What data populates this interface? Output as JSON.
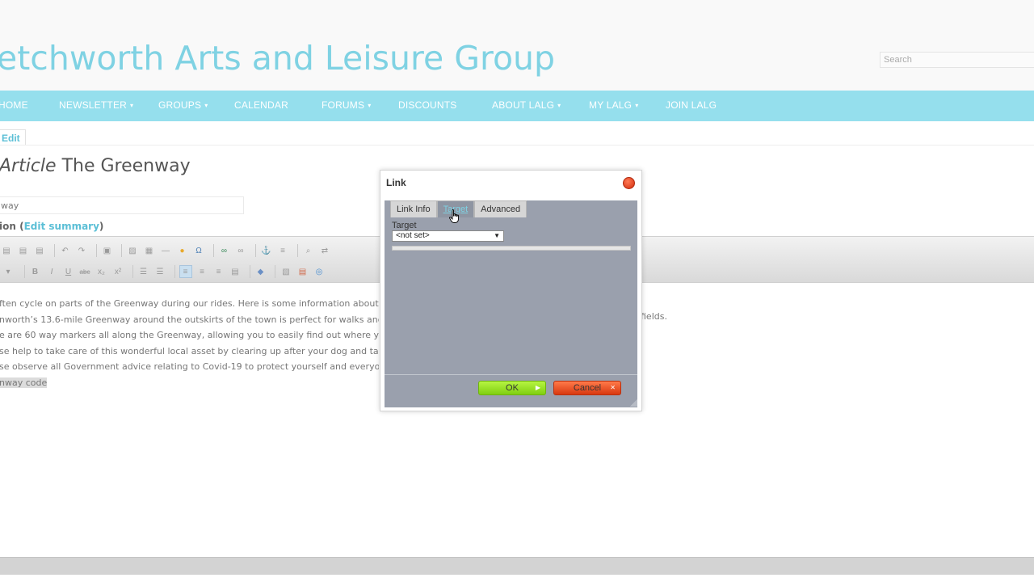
{
  "site": {
    "title": "etchworth Arts and Leisure Group",
    "search_placeholder": "Search"
  },
  "nav": {
    "items": [
      {
        "label": "HOME",
        "has_caret": false
      },
      {
        "label": "NEWSLETTER",
        "has_caret": true
      },
      {
        "label": "GROUPS",
        "has_caret": true
      },
      {
        "label": "CALENDAR",
        "has_caret": false
      },
      {
        "label": "FORUMS",
        "has_caret": true
      },
      {
        "label": "DISCOUNTS",
        "has_caret": false
      },
      {
        "label": "ABOUT LALG",
        "has_caret": true
      },
      {
        "label": "MY LALG",
        "has_caret": true
      },
      {
        "label": "JOIN LALG",
        "has_caret": false
      }
    ],
    "caret": "▾"
  },
  "page": {
    "edit_tab": "Edit",
    "title_italic": "Article",
    "title_rest": " The Greenway",
    "title_field_value": "way",
    "revision_prefix": "ion (",
    "revision_link": "Edit summary",
    "revision_suffix": ")"
  },
  "editor": {
    "lines": [
      "ften cycle on parts of the Greenway during our rides. Here is some information about",
      "nworth’s 13.6-mile Greenway around the outskirts of the town is perfect for walks and",
      "e are 60 way markers all along the Greenway, allowing you to easily find out where y",
      "se help to take care of this wonderful local asset by clearing up after  your dog and ta",
      "se observe all Government advice relating to Covid-19 to protect yourself and everyon"
    ],
    "highlighted_line": "nway code",
    "extra_text": "fields."
  },
  "dialog": {
    "title": "Link",
    "tabs": [
      {
        "label": "Link Info",
        "active": false
      },
      {
        "label": "Target",
        "active": true
      },
      {
        "label": "Advanced",
        "active": false
      }
    ],
    "target_label": "Target",
    "target_value": "<not set>",
    "ok_label": "OK",
    "cancel_label": "Cancel"
  },
  "colors": {
    "brand": "#7fd2e3",
    "nav_bg": "#95dfed",
    "ok": "#8fdc1c",
    "cancel": "#e8501f"
  }
}
